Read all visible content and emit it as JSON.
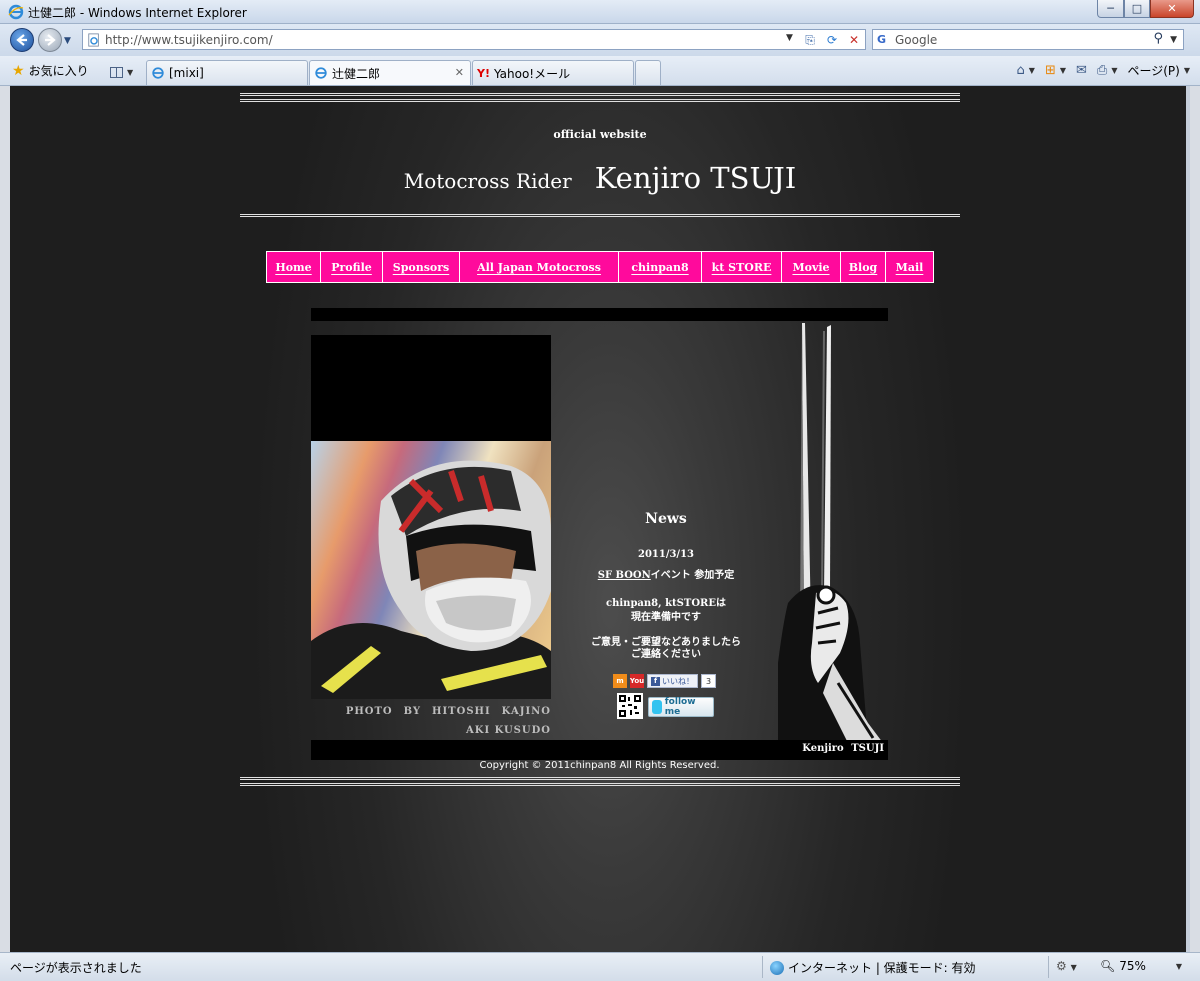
{
  "window": {
    "title": "辻健二郎 - Windows Internet Explorer",
    "controls": {
      "minimize": "─",
      "maximize": "□",
      "close": "✕"
    }
  },
  "address_bar": {
    "url": "http://www.tsujikenjiro.com/",
    "search_placeholder": "Google"
  },
  "favorites": {
    "label": "お気に入り"
  },
  "tabs": [
    {
      "label": "[mixi]"
    },
    {
      "label": "辻健二郎"
    },
    {
      "label": "Yahoo!メール"
    }
  ],
  "command_bar": {
    "page_label": "ページ(P)"
  },
  "site": {
    "tagline": "official website",
    "subtitle": "Motocross Rider",
    "name": "Kenjiro TSUJI",
    "nav": [
      "Home",
      "Profile",
      "Sponsors",
      "All Japan Motocross",
      "chinpan8",
      "kt STORE",
      "Movie",
      "Blog",
      "Mail"
    ],
    "photo_credit": [
      "PHOTO　BY　HITOSHI　KAJINO",
      "AKI KUSUDO"
    ],
    "news": {
      "title": "News",
      "date": "2011/3/13",
      "event_link": "SF BOON",
      "event_rest": "イベント 参加予定",
      "para1": [
        "chinpan8, ktSTOREは",
        "現在準備中です"
      ],
      "para2": [
        "ご意見・ご要望などありましたら",
        "ご連絡ください"
      ]
    },
    "social": {
      "like_label": "いいね！",
      "like_count": "3",
      "follow_label": "follow me"
    },
    "footer_sig": "Kenjiro TSUJI",
    "copyright": "Copyright © 2011chinpan8 All Rights Reserved."
  },
  "status_bar": {
    "message": "ページが表示されました",
    "zone": "インターネット | 保護モード: 有効",
    "zoom": "75%"
  },
  "colors": {
    "nav_bg": "#ff0a9c",
    "page_bg": "#262626"
  }
}
